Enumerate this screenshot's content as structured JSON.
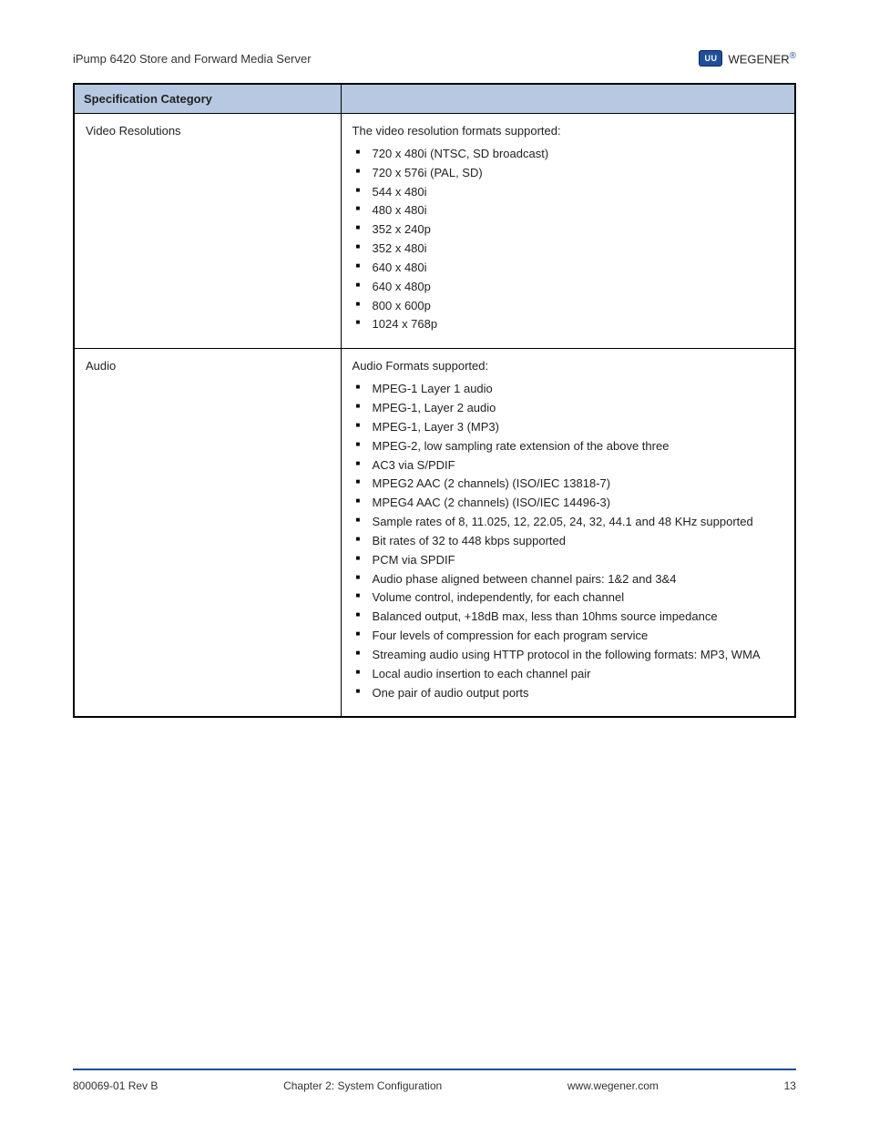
{
  "header": {
    "doc_title": "iPump 6420 Store and Forward Media Server",
    "brand_badge": "UU",
    "brand_text": "WEGENER",
    "reg": "®"
  },
  "table": {
    "col1_header": "Specification Category",
    "col2_header": "",
    "rows": [
      {
        "category": "Video Resolutions",
        "intro": "The video resolution formats supported:",
        "items": [
          "720 x 480i (NTSC, SD broadcast)",
          "720 x 576i (PAL, SD)",
          "544 x 480i",
          "480 x 480i",
          "352 x 240p",
          "352 x 480i",
          "640 x 480i",
          "640 x 480p",
          "800 x 600p",
          "1024 x 768p"
        ]
      },
      {
        "category": "Audio",
        "intro": "Audio Formats supported:",
        "items": [
          "MPEG-1 Layer 1 audio",
          "MPEG-1, Layer 2 audio",
          "MPEG-1, Layer 3 (MP3)",
          "MPEG-2, low sampling rate extension of the above three",
          "AC3 via S/PDIF",
          "MPEG2 AAC (2 channels) (ISO/IEC 13818-7)",
          "MPEG4 AAC (2 channels) (ISO/IEC 14496-3)",
          "Sample rates of 8, 11.025, 12, 22.05, 24, 32, 44.1 and 48 KHz supported",
          "Bit rates of 32 to 448 kbps supported",
          "PCM via SPDIF",
          "Audio phase aligned between channel pairs: 1&2 and 3&4",
          "Volume control, independently, for each channel",
          "Balanced output, +18dB max, less than 10hms source impedance",
          "Four levels of compression for each program service",
          "Streaming audio using HTTP protocol in the following formats: MP3, WMA",
          "Local audio insertion to each channel pair",
          "One pair of audio output ports"
        ]
      }
    ]
  },
  "footer": {
    "left": "800069-01 Rev B",
    "center": "Chapter 2: System Configuration",
    "right": "www.wegener.com",
    "page": "13"
  }
}
